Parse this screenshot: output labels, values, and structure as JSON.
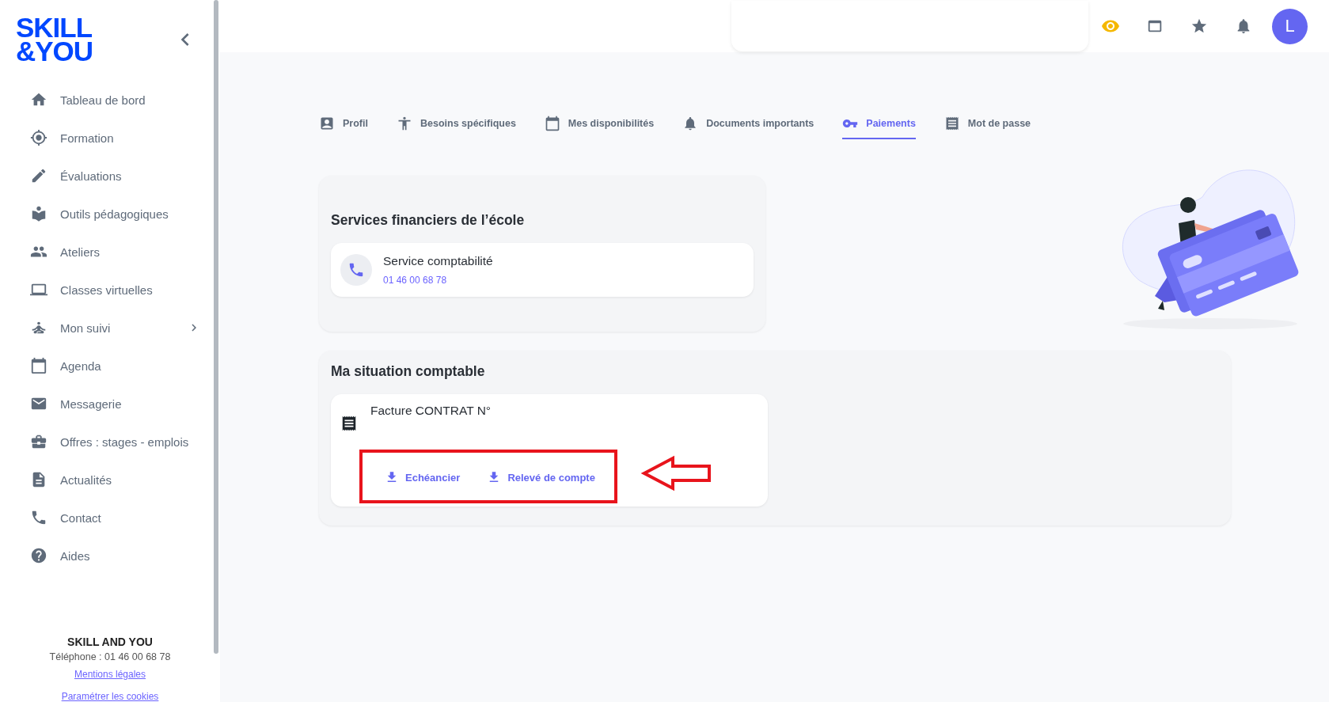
{
  "sidebar": {
    "logo": [
      "SKILL",
      "&YOU"
    ],
    "items": [
      {
        "label": "Tableau de bord",
        "expandable": false
      },
      {
        "label": "Formation",
        "expandable": false
      },
      {
        "label": "Évaluations",
        "expandable": false
      },
      {
        "label": "Outils pédagogiques",
        "expandable": false
      },
      {
        "label": "Ateliers",
        "expandable": false
      },
      {
        "label": "Classes virtuelles",
        "expandable": false
      },
      {
        "label": "Mon suivi",
        "expandable": true
      },
      {
        "label": "Agenda",
        "expandable": false
      },
      {
        "label": "Messagerie",
        "expandable": false
      },
      {
        "label": "Offres : stages - emplois",
        "expandable": false
      },
      {
        "label": "Actualités",
        "expandable": false
      },
      {
        "label": "Contact",
        "expandable": false
      },
      {
        "label": "Aides",
        "expandable": false
      }
    ],
    "footer": {
      "company": "SKILL AND YOU",
      "phone": "Téléphone : 01 46 00 68 78",
      "links": [
        "Mentions légales",
        "Paramétrer les cookies"
      ]
    }
  },
  "topbar": {
    "avatar": "L"
  },
  "tabs": [
    {
      "label": "Profil",
      "selected": false
    },
    {
      "label": "Besoins spécifiques",
      "selected": false
    },
    {
      "label": "Mes disponibilités",
      "selected": false
    },
    {
      "label": "Documents importants",
      "selected": false
    },
    {
      "label": "Paiements",
      "selected": true
    },
    {
      "label": "Mot de passe",
      "selected": false
    }
  ],
  "services": {
    "title": "Services financiers de l’école",
    "contact": {
      "name": "Service comptabilité",
      "phone": "01 46 00 68 78"
    }
  },
  "situation": {
    "title": "Ma situation comptable",
    "invoice": {
      "title": "Facture CONTRAT N°",
      "downloads": [
        "Echéancier",
        "Relevé de compte"
      ]
    }
  }
}
